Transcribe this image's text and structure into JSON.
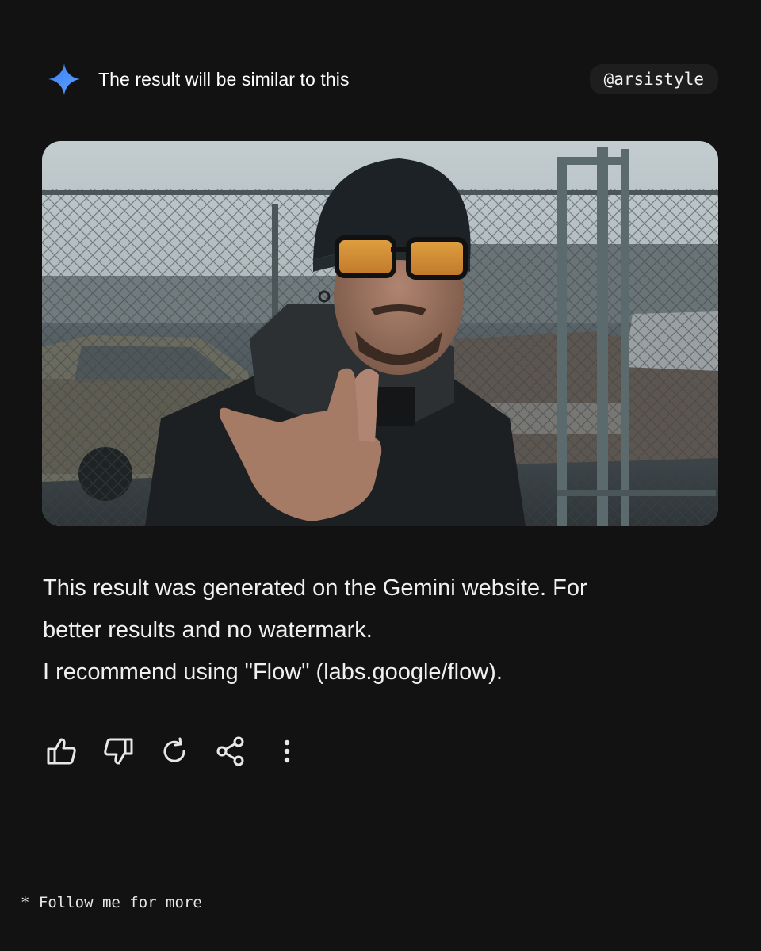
{
  "header": {
    "icon": "gemini-sparkle-icon",
    "title": "The result will be similar to this",
    "handle": "@arsistyle"
  },
  "image": {
    "subject": "generated-photo"
  },
  "message": {
    "line1": "This result was generated on the Gemini website. For",
    "line2": "better results and no watermark.",
    "line3": "I recommend using \"Flow\" (labs.google/flow)."
  },
  "actions": [
    {
      "icon": "thumbs-up-icon"
    },
    {
      "icon": "thumbs-down-icon"
    },
    {
      "icon": "regenerate-icon"
    },
    {
      "icon": "share-icon"
    },
    {
      "icon": "more-vert-icon"
    }
  ],
  "footer": {
    "text": "* Follow me for more"
  },
  "colors": {
    "background": "#121212",
    "accent": "#4a8df7",
    "text": "#ffffff"
  }
}
